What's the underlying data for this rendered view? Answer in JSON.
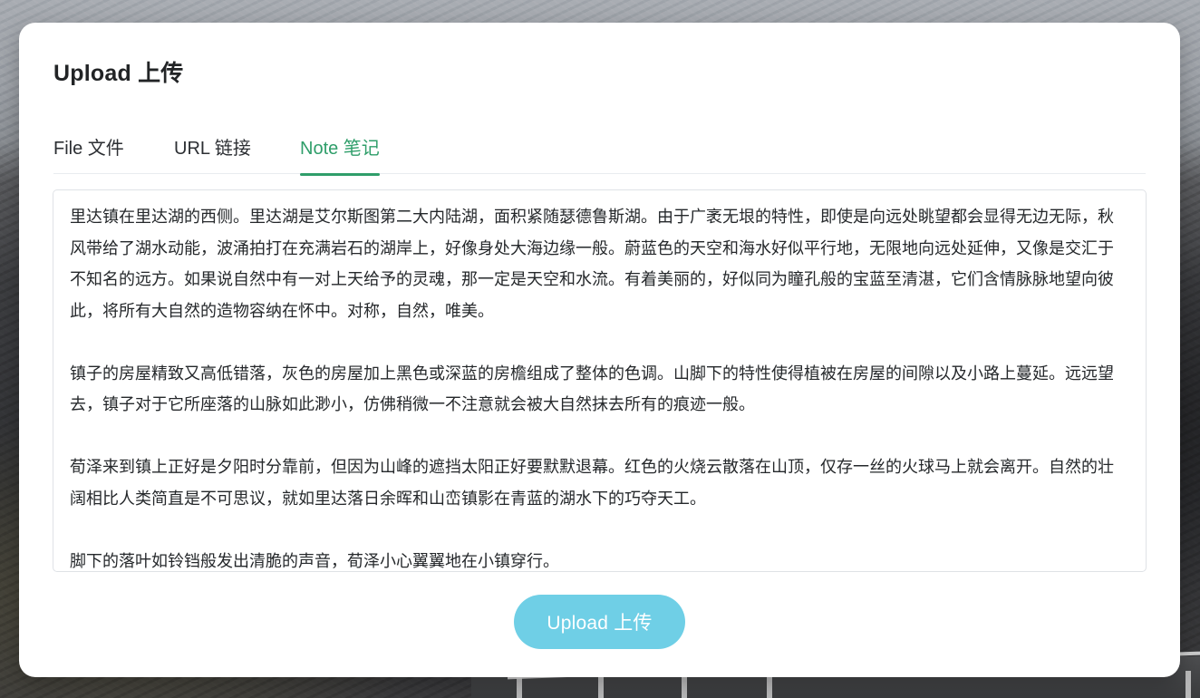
{
  "modal": {
    "title": "Upload 上传"
  },
  "tabs": [
    {
      "label": "File 文件",
      "active": false
    },
    {
      "label": "URL 链接",
      "active": false
    },
    {
      "label": "Note 笔记",
      "active": true
    }
  ],
  "note": {
    "value": "里达镇在里达湖的西侧。里达湖是艾尔斯图第二大内陆湖，面积紧随瑟德鲁斯湖。由于广袤无垠的特性，即使是向远处眺望都会显得无边无际，秋风带给了湖水动能，波涌拍打在充满岩石的湖岸上，好像身处大海边缘一般。蔚蓝色的天空和海水好似平行地，无限地向远处延伸，又像是交汇于不知名的远方。如果说自然中有一对上天给予的灵魂，那一定是天空和水流。有着美丽的，好似同为瞳孔般的宝蓝至清湛，它们含情脉脉地望向彼此，将所有大自然的造物容纳在怀中。对称，自然，唯美。\n\n镇子的房屋精致又高低错落，灰色的房屋加上黑色或深蓝的房檐组成了整体的色调。山脚下的特性使得植被在房屋的间隙以及小路上蔓延。远远望去，镇子对于它所座落的山脉如此渺小，仿佛稍微一不注意就会被大自然抹去所有的痕迹一般。\n\n荀泽来到镇上正好是夕阳时分靠前，但因为山峰的遮挡太阳正好要默默退幕。红色的火烧云散落在山顶，仅存一丝的火球马上就会离开。自然的壮阔相比人类简直是不可思议，就如里达落日余晖和山峦镇影在青蓝的湖水下的巧夺天工。\n\n脚下的落叶如铃铛般发出清脆的声音，荀泽小心翼翼地在小镇穿行。"
  },
  "upload_button": {
    "label": "Upload 上传"
  },
  "colors": {
    "accent": "#2f9e6a",
    "button": "#6fcfe6",
    "modal_bg": "#ffffff",
    "text": "#25282b"
  }
}
